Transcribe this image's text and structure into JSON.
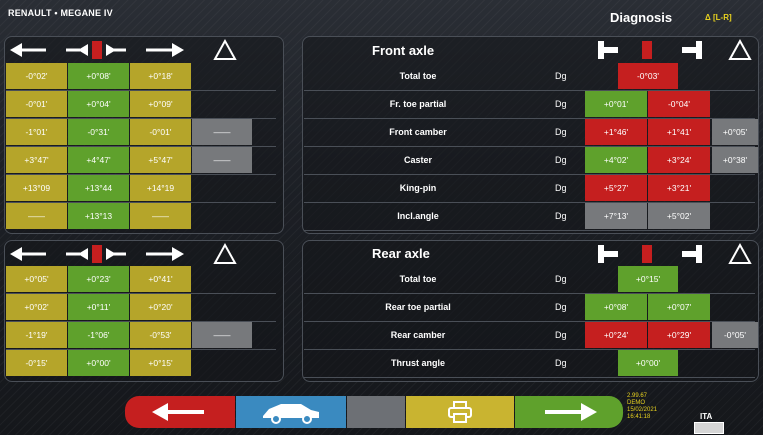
{
  "header": {
    "vehicle": "RENAULT • MEGANE IV",
    "title": "Diagnosis",
    "side_indicator": "Δ [L-R]"
  },
  "front": {
    "title": "Front axle",
    "left_rows": [
      {
        "cells": [
          {
            "v": "-0°02'",
            "c": "y"
          },
          {
            "v": "+0°08'",
            "c": "g"
          },
          {
            "v": "+0°18'",
            "c": "y"
          },
          {
            "v": "",
            "c": "dk"
          }
        ]
      },
      {
        "cells": [
          {
            "v": "-0°01'",
            "c": "y"
          },
          {
            "v": "+0°04'",
            "c": "g"
          },
          {
            "v": "+0°09'",
            "c": "y"
          },
          {
            "v": "",
            "c": "dk"
          }
        ]
      },
      {
        "cells": [
          {
            "v": "-1°01'",
            "c": "y"
          },
          {
            "v": "-0°31'",
            "c": "g"
          },
          {
            "v": "-0°01'",
            "c": "y"
          },
          {
            "v": "——",
            "c": "gr"
          }
        ]
      },
      {
        "cells": [
          {
            "v": "+3°47'",
            "c": "y"
          },
          {
            "v": "+4°47'",
            "c": "g"
          },
          {
            "v": "+5°47'",
            "c": "y"
          },
          {
            "v": "——",
            "c": "gr"
          }
        ]
      },
      {
        "cells": [
          {
            "v": "+13°09",
            "c": "y"
          },
          {
            "v": "+13°44",
            "c": "g"
          },
          {
            "v": "+14°19",
            "c": "y"
          },
          {
            "v": "",
            "c": "dk"
          }
        ]
      },
      {
        "cells": [
          {
            "v": "——",
            "c": "y"
          },
          {
            "v": "+13°13",
            "c": "g"
          },
          {
            "v": "——",
            "c": "y"
          },
          {
            "v": "",
            "c": "dk"
          }
        ]
      }
    ],
    "right_rows": [
      {
        "label": "Total toe",
        "unit": "Dg",
        "mode": "single",
        "single": {
          "v": "-0°03'",
          "c": "r"
        },
        "delta": ""
      },
      {
        "label": "Fr. toe partial",
        "unit": "Dg",
        "mode": "pair",
        "l": {
          "v": "+0°01'",
          "c": "g"
        },
        "r": {
          "v": "-0°04'",
          "c": "r"
        },
        "delta": ""
      },
      {
        "label": "Front camber",
        "unit": "Dg",
        "mode": "pair",
        "l": {
          "v": "+1°46'",
          "c": "r"
        },
        "r": {
          "v": "+1°41'",
          "c": "r"
        },
        "delta": "+0°05'"
      },
      {
        "label": "Caster",
        "unit": "Dg",
        "mode": "pair",
        "l": {
          "v": "+4°02'",
          "c": "g"
        },
        "r": {
          "v": "+3°24'",
          "c": "r"
        },
        "delta": "+0°38'"
      },
      {
        "label": "King-pin",
        "unit": "Dg",
        "mode": "pair",
        "l": {
          "v": "+5°27'",
          "c": "r"
        },
        "r": {
          "v": "+3°21'",
          "c": "r"
        },
        "delta": ""
      },
      {
        "label": "Incl.angle",
        "unit": "Dg",
        "mode": "pair",
        "l": {
          "v": "+7°13'",
          "c": "gr"
        },
        "r": {
          "v": "+5°02'",
          "c": "gr"
        },
        "delta": ""
      }
    ]
  },
  "rear": {
    "title": "Rear axle",
    "left_rows": [
      {
        "cells": [
          {
            "v": "+0°05'",
            "c": "y"
          },
          {
            "v": "+0°23'",
            "c": "g"
          },
          {
            "v": "+0°41'",
            "c": "y"
          },
          {
            "v": "",
            "c": "dk"
          }
        ]
      },
      {
        "cells": [
          {
            "v": "+0°02'",
            "c": "y"
          },
          {
            "v": "+0°11'",
            "c": "g"
          },
          {
            "v": "+0°20'",
            "c": "y"
          },
          {
            "v": "",
            "c": "dk"
          }
        ]
      },
      {
        "cells": [
          {
            "v": "-1°19'",
            "c": "y"
          },
          {
            "v": "-1°06'",
            "c": "g"
          },
          {
            "v": "-0°53'",
            "c": "y"
          },
          {
            "v": "——",
            "c": "gr"
          }
        ]
      },
      {
        "cells": [
          {
            "v": "-0°15'",
            "c": "y"
          },
          {
            "v": "+0°00'",
            "c": "g"
          },
          {
            "v": "+0°15'",
            "c": "y"
          },
          {
            "v": "",
            "c": "dk"
          }
        ]
      }
    ],
    "right_rows": [
      {
        "label": "Total toe",
        "unit": "Dg",
        "mode": "single",
        "single": {
          "v": "+0°15'",
          "c": "g"
        },
        "delta": ""
      },
      {
        "label": "Rear toe partial",
        "unit": "Dg",
        "mode": "pair",
        "l": {
          "v": "+0°08'",
          "c": "g"
        },
        "r": {
          "v": "+0°07'",
          "c": "g"
        },
        "delta": ""
      },
      {
        "label": "Rear camber",
        "unit": "Dg",
        "mode": "pair",
        "l": {
          "v": "+0°24'",
          "c": "r"
        },
        "r": {
          "v": "+0°29'",
          "c": "r"
        },
        "delta": "-0°05'"
      },
      {
        "label": "Thrust angle",
        "unit": "Dg",
        "mode": "single",
        "single": {
          "v": "+0°00'",
          "c": "g"
        },
        "delta": ""
      }
    ]
  },
  "footer": {
    "info_lines": [
      "2.99.67",
      "DEMO",
      "15/02/2021",
      "16:41:18"
    ],
    "language": "ITA",
    "icons": [
      "back-arrow-icon",
      "car-icon",
      "blank",
      "printer-icon",
      "forward-arrow-icon"
    ],
    "colors": {
      "back": "#c51f1f",
      "car": "#3a8ac0",
      "blank": "#6d7075",
      "print": "#c9b430",
      "forward": "#5fa12c"
    }
  }
}
